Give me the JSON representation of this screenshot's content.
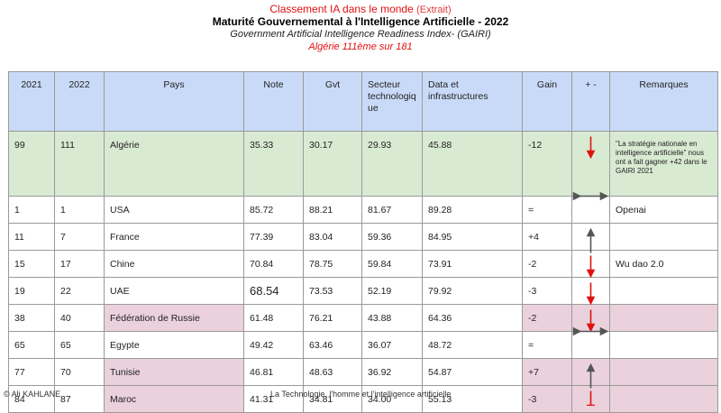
{
  "header": {
    "line1": "Classement IA dans le monde",
    "line1_extra": "(Extrait)",
    "line2": "Maturité Gouvernemental à l'Intelligence Artificielle - 2022",
    "line3": "Government Artificial Intelligence Readiness Index- (GAIRI)",
    "line4": "Algérie 111ème sur 181"
  },
  "columns": {
    "y2021": "2021",
    "y2022": "2022",
    "pays": "Pays",
    "note": "Note",
    "gvt": "Gvt",
    "secteur": "Secteur technologiq ue",
    "data": "Data et infrastructures",
    "gain": "Gain",
    "plusminus": "+ -",
    "remarques": "Remarques"
  },
  "rows": [
    {
      "y2021": "99",
      "y2022": "111",
      "pays": "Algérie",
      "note": "35.33",
      "gvt": "30.17",
      "secteur": "29.93",
      "data": "45.88",
      "gain": "-12",
      "trend": "down",
      "remarque": "\"La stratégie nationale en intelligence artificielle\" nous ont a fait  gagner +42 dans le GAIRI 2021"
    },
    {
      "y2021": "1",
      "y2022": "1",
      "pays": "USA",
      "note": "85.72",
      "gvt": "88.21",
      "secteur": "81.67",
      "data": "89.28",
      "gain": "=",
      "trend": "same",
      "remarque": "Openai"
    },
    {
      "y2021": "11",
      "y2022": "7",
      "pays": "France",
      "note": "77.39",
      "gvt": "83.04",
      "secteur": "59.36",
      "data": "84.95",
      "gain": "+4",
      "trend": "up",
      "remarque": ""
    },
    {
      "y2021": "15",
      "y2022": "17",
      "pays": "Chine",
      "note": "70.84",
      "gvt": "78.75",
      "secteur": "59.84",
      "data": "73.91",
      "gain": "-2",
      "trend": "down",
      "remarque": "Wu dao 2.0"
    },
    {
      "y2021": "19",
      "y2022": "22",
      "pays": "UAE",
      "note": "68.54",
      "gvt": "73.53",
      "secteur": "52.19",
      "data": "79.92",
      "gain": "-3",
      "trend": "down",
      "remarque": ""
    },
    {
      "y2021": "38",
      "y2022": "40",
      "pays": "Fédération de Russie",
      "note": "61.48",
      "gvt": "76.21",
      "secteur": "43.88",
      "data": "64.36",
      "gain": "-2",
      "trend": "down",
      "remarque": ""
    },
    {
      "y2021": "65",
      "y2022": "65",
      "pays": "Egypte",
      "note": "49.42",
      "gvt": "63.46",
      "secteur": "36.07",
      "data": "48.72",
      "gain": "=",
      "trend": "same",
      "remarque": ""
    },
    {
      "y2021": "77",
      "y2022": "70",
      "pays": "Tunisie",
      "note": "46.81",
      "gvt": "48.63",
      "secteur": "36.92",
      "data": "54.87",
      "gain": "+7",
      "trend": "up",
      "remarque": ""
    },
    {
      "y2021": "84",
      "y2022": "87",
      "pays": "Maroc",
      "note": "41.31",
      "gvt": "34.81",
      "secteur": "34.00",
      "data": "55.13",
      "gain": "-3",
      "trend": "down",
      "remarque": ""
    }
  ],
  "footer": {
    "author": "© Ali KAHLANE",
    "subtitle": "La Technologie, l'homme et l'intelligence artificielle"
  },
  "colors": {
    "header_bg": "#c9daf8",
    "algeria_bg": "#d9ead3",
    "highlight_bg": "#ead1dc",
    "arrow_down": "#e01010",
    "arrow_neutral": "#555555",
    "title_red": "#e01010"
  }
}
